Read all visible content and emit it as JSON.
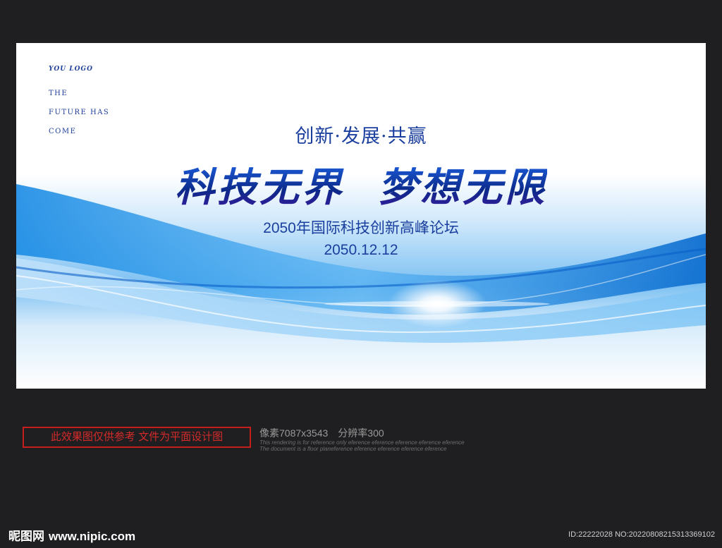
{
  "poster": {
    "logo": "YOU LOGO",
    "tagline": [
      "THE",
      "FUTURE HAS",
      "COME"
    ],
    "slogan": "创新·发展·共赢",
    "headline_left": "科技无界",
    "headline_right": "梦想无限",
    "forum": "2050年国际科技创新高峰论坛",
    "date": "2050.12.12"
  },
  "footer": {
    "notice": "此效果图仅供参考 文件为平面设计图",
    "specs_pixels": "像素7087x3543",
    "specs_resolution": "分辨率300",
    "disclaimer_1": "This rendering is for reference only  eference eference eference eference eference",
    "disclaimer_2": "The document is a floor planeference eference eference eference eference",
    "brand_cn": "昵图网",
    "brand_url": "www.nipic.com",
    "id_text": "ID:22222028 NO:20220808215313369102"
  },
  "colors": {
    "page_bg": "#1f1f21",
    "text_blue": "#1a3f9e",
    "wave_blue": "#1b8ee6",
    "notice_red": "#c61d1d"
  }
}
